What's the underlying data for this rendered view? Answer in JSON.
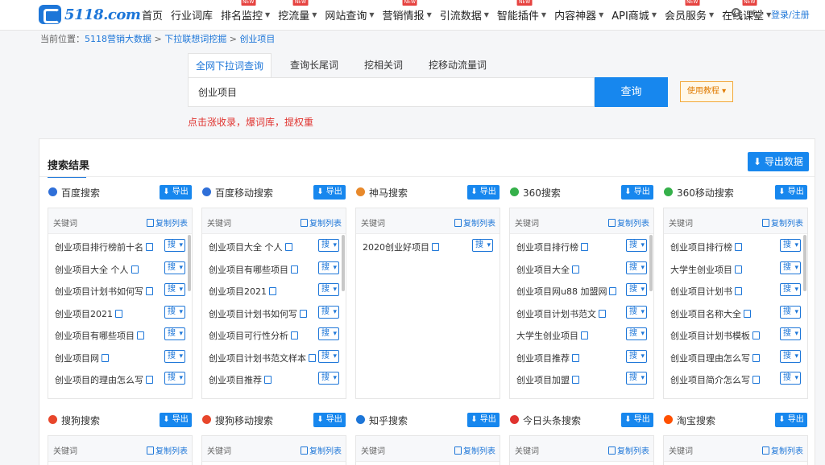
{
  "nav": {
    "logo_text": "5118.com",
    "items": [
      {
        "label": "首页",
        "caret": false,
        "hot": false
      },
      {
        "label": "行业词库",
        "caret": false,
        "hot": false
      },
      {
        "label": "排名监控",
        "caret": true,
        "hot": true
      },
      {
        "label": "挖流量",
        "caret": true,
        "hot": true
      },
      {
        "label": "网站查询",
        "caret": true,
        "hot": false
      },
      {
        "label": "营销情报",
        "caret": true,
        "hot": true
      },
      {
        "label": "引流数据",
        "caret": true,
        "hot": false
      },
      {
        "label": "智能插件",
        "caret": true,
        "hot": true
      },
      {
        "label": "内容神器",
        "caret": true,
        "hot": false
      },
      {
        "label": "API商城",
        "caret": true,
        "hot": false
      },
      {
        "label": "会员服务",
        "caret": true,
        "hot": true
      },
      {
        "label": "在线课堂",
        "caret": true,
        "hot": true
      }
    ],
    "hot_label": "NEW",
    "login": "登录/注册"
  },
  "breadcrumb": {
    "prefix": "当前位置：",
    "items": [
      "5118营销大数据",
      "下拉联想词挖掘",
      "创业项目"
    ],
    "sep": " > "
  },
  "search": {
    "tabs": [
      "全网下拉词查询",
      "查询长尾词",
      "挖相关词",
      "挖移动流量词"
    ],
    "active_tab": 0,
    "value": "创业项目",
    "button": "查询",
    "tutorial": "使用教程",
    "promo": "点击涨收录，爆词库，提权重"
  },
  "results": {
    "title": "搜索结果",
    "export_all": "导出数据",
    "card_export": "导出",
    "col_keyword": "关键词",
    "copy_list": "复制列表",
    "sou": "搜",
    "cards": [
      {
        "name": "百度搜索",
        "icon": "baidu-paw-icon",
        "color": "#2f6fd8",
        "rows": [
          "创业项目排行榜前十名",
          "创业项目大全 个人",
          "创业项目计划书如何写",
          "创业项目2021",
          "创业项目有哪些项目",
          "创业项目网",
          "创业项目的理由怎么写"
        ]
      },
      {
        "name": "百度移动搜索",
        "icon": "baidu-paw-icon",
        "color": "#2f6fd8",
        "rows": [
          "创业项目大全 个人",
          "创业项目有哪些项目",
          "创业项目2021",
          "创业项目计划书如何写",
          "创业项目可行性分析",
          "创业项目计划书范文样本",
          "创业项目推荐"
        ]
      },
      {
        "name": "神马搜索",
        "icon": "shenma-icon",
        "color": "#e8892b",
        "rows": [
          "2020创业好项目"
        ]
      },
      {
        "name": "360搜索",
        "icon": "360-icon",
        "color": "#35b04a",
        "rows": [
          "创业项目排行榜",
          "创业项目大全",
          "创业项目网u88 加盟网",
          "创业项目计划书范文",
          "大学生创业项目",
          "创业项目推荐",
          "创业项目加盟"
        ]
      },
      {
        "name": "360移动搜索",
        "icon": "360-icon",
        "color": "#35b04a",
        "rows": [
          "创业项目排行榜",
          "大学生创业项目",
          "创业项目计划书",
          "创业项目名称大全",
          "创业项目计划书模板",
          "创业项目理由怎么写",
          "创业项目简介怎么写"
        ]
      },
      {
        "name": "搜狗搜索",
        "icon": "sogou-icon",
        "color": "#e8462b",
        "rows": []
      },
      {
        "name": "搜狗移动搜索",
        "icon": "sogou-icon",
        "color": "#e8462b",
        "rows": []
      },
      {
        "name": "知乎搜索",
        "icon": "zhihu-icon",
        "color": "#1d76d8",
        "rows": []
      },
      {
        "name": "今日头条搜索",
        "icon": "toutiao-icon",
        "color": "#e0332f",
        "rows": []
      },
      {
        "name": "淘宝搜索",
        "icon": "taobao-icon",
        "color": "#ff5000",
        "rows": []
      }
    ]
  }
}
